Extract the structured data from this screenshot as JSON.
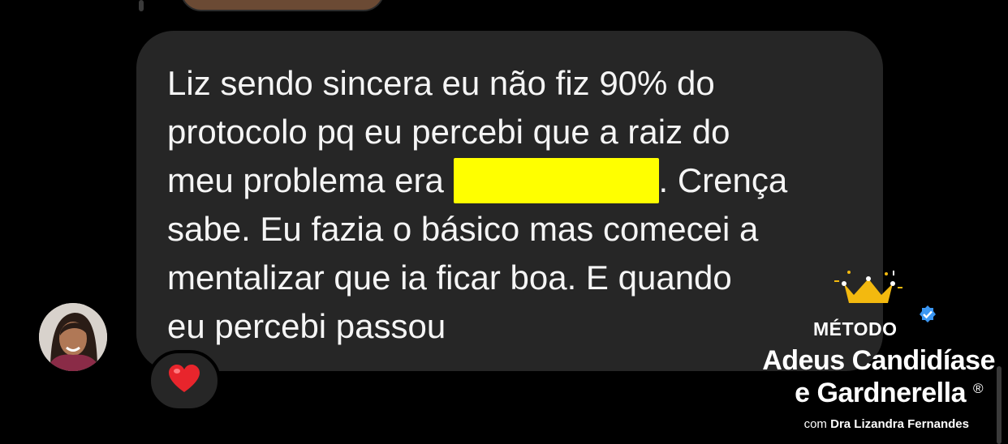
{
  "message": {
    "line1": "Liz sendo sincera eu não fiz 90% do",
    "line2": "protocolo pq eu percebi que a raiz do",
    "line3_before": "meu problema era ",
    "line3_after": ". Crença",
    "line4": "sabe. Eu fazia o básico mas comecei a",
    "line5": "mentalizar que ia ficar boa. E quando",
    "line6": "eu percebi passou",
    "redaction_color": "#ffff00"
  },
  "reaction": {
    "icon": "heart-icon",
    "glyph": "❤️"
  },
  "avatar": {
    "icon": "user-avatar"
  },
  "brand": {
    "metodo": "MÉTODO",
    "title_line1": "Adeus Candidíase",
    "title_line2": "e Gardnerella",
    "registered": "®",
    "sub_prefix": "com ",
    "sub_name": "Dra Lizandra Fernandes",
    "accent_color": "#f3b90f",
    "verified_color": "#3b97f3"
  },
  "colors": {
    "background": "#000000",
    "bubble": "#262626",
    "text": "#f5f5f5"
  }
}
